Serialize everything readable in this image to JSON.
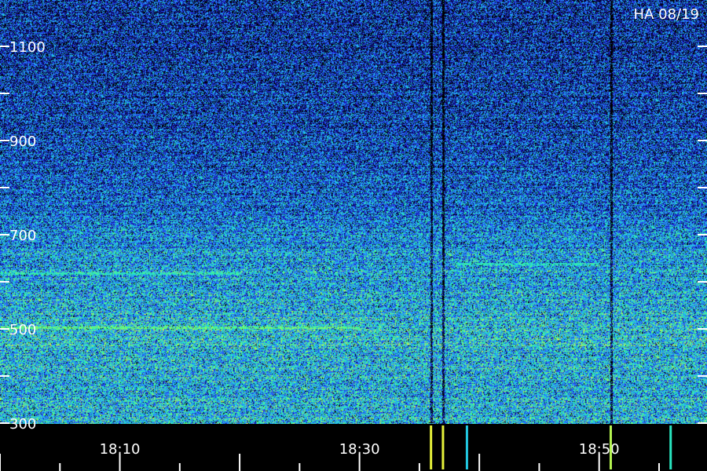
{
  "chart_data": {
    "type": "heatmap",
    "title": "HA 08/19",
    "xlabel": "",
    "ylabel": "",
    "y_ticks": [
      300,
      500,
      700,
      900,
      1100
    ],
    "y_minor_ticks": [
      400,
      600,
      800,
      1000
    ],
    "ylim": [
      300,
      1200
    ],
    "x_ticks": [
      "18:10",
      "18:30",
      "18:50"
    ],
    "xlim": [
      "18:00",
      "18:59"
    ],
    "grid": false,
    "colormap": [
      "#000000",
      "#10109a",
      "#2a3cff",
      "#23a8ff",
      "#22e0d0",
      "#44ff88",
      "#e6f03a"
    ],
    "noise_profile": {
      "frequencies": [
        300,
        400,
        500,
        600,
        700,
        800,
        900,
        1000,
        1100,
        1200
      ],
      "mean_intensity": [
        0.62,
        0.6,
        0.64,
        0.58,
        0.5,
        0.38,
        0.34,
        0.3,
        0.28,
        0.26
      ]
    },
    "bright_lines": [
      {
        "frequency": 505,
        "start": "18:00",
        "end": "18:30",
        "intensity": 0.85
      },
      {
        "frequency": 620,
        "start": "18:00",
        "end": "18:20",
        "intensity": 0.7
      },
      {
        "frequency": 640,
        "start": "18:38",
        "end": "18:50",
        "intensity": 0.7
      }
    ],
    "dark_columns": [
      "18:36",
      "18:37",
      "18:51"
    ],
    "bright_events": [
      {
        "time": "18:36",
        "intensity": 1.0
      },
      {
        "time": "18:37",
        "intensity": 1.0
      },
      {
        "time": "18:39",
        "intensity": 0.6
      },
      {
        "time": "18:51",
        "intensity": 0.95
      },
      {
        "time": "18:56",
        "intensity": 0.7
      }
    ]
  }
}
